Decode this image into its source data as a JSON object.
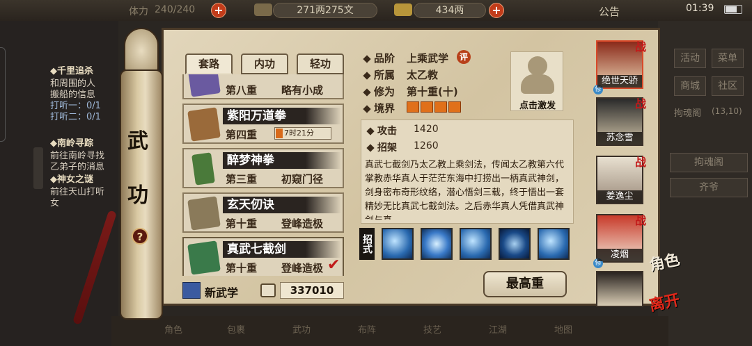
{
  "topbar": {
    "stamina_label": "体力",
    "stamina_value": "240/240",
    "silver": "271两275文",
    "gold": "434两",
    "notice": "公告",
    "time": "01:39"
  },
  "quests": [
    {
      "title": "◆千里追杀",
      "lines": [
        "和周围的人",
        "搬船的信息",
        "打听一：0/1",
        "打听二：0/1"
      ]
    },
    {
      "title": "◆南岭寻踪",
      "lines": [
        "前往南岭寻找",
        "乙弟子的消息"
      ]
    },
    {
      "title": "◆神女之谜",
      "lines": [
        "前往天山打听",
        "女"
      ]
    }
  ],
  "scroll": {
    "title_1": "武",
    "title_2": "功",
    "help": "?"
  },
  "tabs": [
    "套路",
    "内功",
    "轻功"
  ],
  "skill_list": [
    {
      "name": "",
      "level": "第八重",
      "status": "略有小成"
    },
    {
      "name": "紫阳万道拳",
      "level": "第四重",
      "status": "7时21分"
    },
    {
      "name": "醉梦神拳",
      "level": "第三重",
      "status": "初窥门径"
    },
    {
      "name": "玄天仞诀",
      "level": "第十重",
      "status": "登峰造极"
    },
    {
      "name": "真武七截剑",
      "level": "第十重",
      "status": "登峰造极"
    }
  ],
  "new_skill_label": "新武学",
  "points": "337010",
  "detail": {
    "grade_label": "品阶",
    "grade_value": "上乘武学",
    "grade_badge": "评",
    "sect_label": "所属",
    "sect_value": "太乙教",
    "cultivation_label": "修为",
    "cultivation_value": "第十重(十)",
    "realm_label": "境界",
    "realm_level": 4,
    "activate_label": "点击激发",
    "attack_label": "攻击",
    "attack_value": "1420",
    "parry_label": "招架",
    "parry_value": "1260",
    "description": "真武七截剑乃太乙教上乘剑法，传闻太乙教第六代掌教赤华真人于茫茫东海中打捞出一柄真武神剑，剑身密布奇形纹络，潜心悟剑三载，终于悟出一套精妙无比真武七截剑法。之后赤华真人凭借真武神剑与真",
    "moves_label": "招式",
    "max_button": "最高重"
  },
  "party": [
    {
      "name": "绝世天骄",
      "battle": "战",
      "badge": "修"
    },
    {
      "name": "苏念雪",
      "battle": "战",
      "badge": ""
    },
    {
      "name": "姜逸尘",
      "battle": "战",
      "badge": ""
    },
    {
      "name": "凌烟",
      "battle": "战",
      "badge": "修"
    },
    {
      "name": "",
      "battle": "",
      "badge": ""
    }
  ],
  "side_labels": {
    "role": "角色",
    "leave": "离开"
  },
  "right_menu": {
    "activity": "活动",
    "menu": "菜单",
    "shop": "商城",
    "community": "社区",
    "soul_hall": "拘魂阁",
    "soul_hall_count": "(13,10)",
    "soul_hall_btn": "拘魂阁",
    "qi_btn": "齐爷"
  },
  "bottom_nav": [
    "角色",
    "包裹",
    "武功",
    "布阵",
    "技艺",
    "江湖",
    "地图"
  ]
}
